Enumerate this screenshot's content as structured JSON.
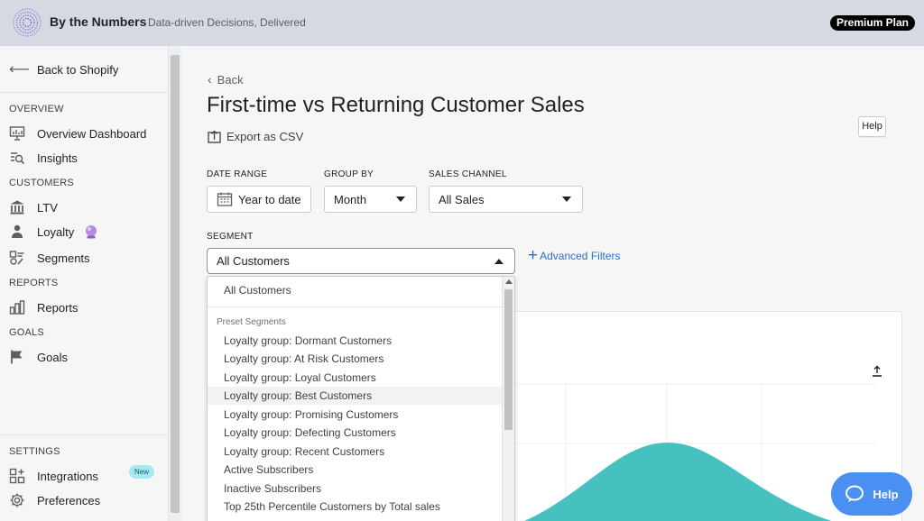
{
  "header": {
    "app_name": "By the Numbers",
    "tagline": "Data-driven Decisions, Delivered",
    "plan_badge": "Premium Plan"
  },
  "sidebar": {
    "back_label": "Back to Shopify",
    "sections": {
      "overview": "OVERVIEW",
      "customers": "CUSTOMERS",
      "reports": "REPORTS",
      "goals": "GOALS",
      "settings": "SETTINGS"
    },
    "items": {
      "overview_dashboard": "Overview Dashboard",
      "insights": "Insights",
      "ltv": "LTV",
      "loyalty": "Loyalty",
      "segments": "Segments",
      "reports": "Reports",
      "goals": "Goals",
      "integrations": "Integrations",
      "integrations_badge": "New",
      "preferences": "Preferences"
    }
  },
  "main": {
    "back_label": "Back",
    "title": "First-time vs Returning Customer Sales",
    "export_label": "Export as CSV",
    "help_label": "Help",
    "filters": {
      "date_range_label": "DATE RANGE",
      "date_range_value": "Year to date",
      "group_by_label": "GROUP BY",
      "group_by_value": "Month",
      "sales_channel_label": "SALES CHANNEL",
      "sales_channel_value": "All Sales",
      "segment_label": "SEGMENT",
      "segment_value": "All Customers",
      "advanced_filters_label": "Advanced Filters"
    }
  },
  "dropdown": {
    "first_option": "All Customers",
    "group_label": "Preset Segments",
    "options": [
      "Loyalty group: Dormant Customers",
      "Loyalty group: At Risk Customers",
      "Loyalty group: Loyal Customers",
      "Loyalty group: Best Customers",
      "Loyalty group: Promising Customers",
      "Loyalty group: Defecting Customers",
      "Loyalty group: Recent Customers",
      "Active Subscribers",
      "Inactive Subscribers",
      "Top 25th Percentile Customers by Total sales"
    ],
    "highlighted_index": 3
  },
  "help_widget": {
    "label": "Help"
  },
  "colors": {
    "accent": "#2c6ecb",
    "chart_fill": "#47c1bf",
    "help_button": "#4a90f3",
    "topbar": "#d5d9e2"
  }
}
